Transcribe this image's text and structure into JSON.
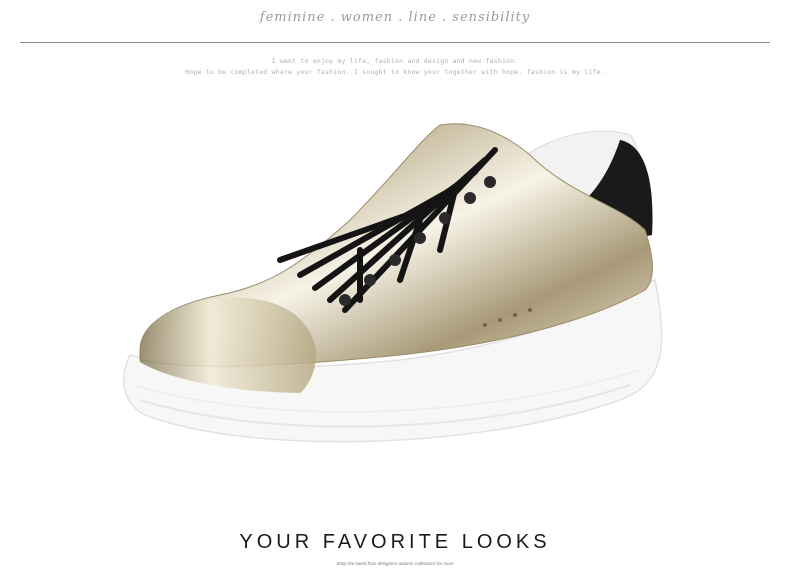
{
  "header": {
    "tagline": "feminine . women . line . sensibility",
    "sub_line_1": "I want to enjoy my life, fashion and design and new fashion.",
    "sub_line_2": "Hope to be completed where your fashion. I sought to know your together with hope. fashion is my life."
  },
  "footer": {
    "headline": "YOUR FAVORITE LOOKS",
    "caption": "Shop the latest from designers autumn collections for more"
  },
  "product_image": {
    "subject": "metallic gold platform sneaker with black laces and black heel tab",
    "colors": {
      "upper": "#d8cfb8",
      "laces": "#141414",
      "sole": "#f7f7f7",
      "heel_tab": "#1a1a1a"
    }
  }
}
